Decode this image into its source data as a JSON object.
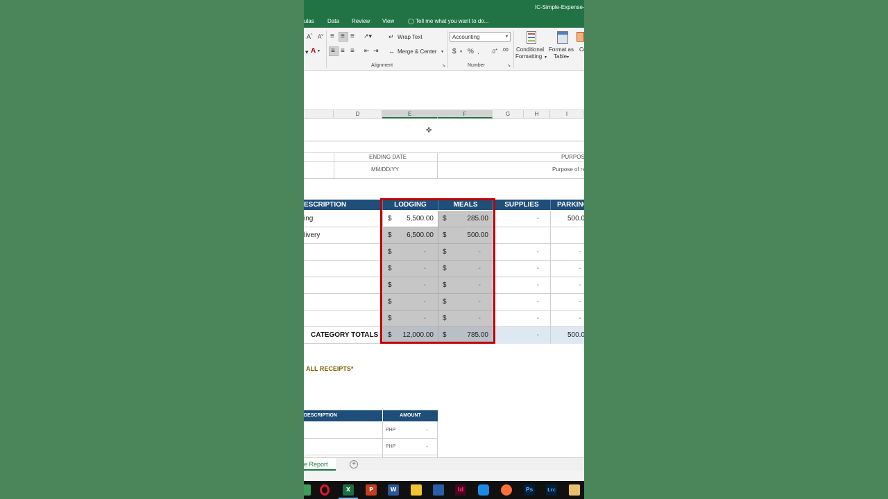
{
  "window": {
    "title": "IC-Simple-Expense-"
  },
  "menu_tabs": [
    "ulas",
    "Data",
    "Review",
    "View"
  ],
  "tell_me": "Tell me what you want to do...",
  "ribbon": {
    "wrap_text": "Wrap Text",
    "merge_center": "Merge & Center",
    "alignment_label": "Alignment",
    "number_format": "Accounting",
    "number_label": "Number",
    "dollar": "$",
    "percent": "%",
    "conditional_formatting_1": "Conditional",
    "conditional_formatting_2": "Formatting",
    "format_as_table_1": "Format as",
    "format_as_table_2": "Table",
    "cell_styles_short": "Ce"
  },
  "columns": [
    "D",
    "E",
    "F",
    "G",
    "H",
    "I"
  ],
  "info": {
    "ending_date_label": "ENDING DATE",
    "ending_date_value": "MM/DD/YY",
    "purpose_label": "PURPOSE",
    "purpose_value": "Purpose of re"
  },
  "table": {
    "headers": {
      "description": "ESCRIPTION",
      "lodging": "LODGING",
      "meals": "MEALS",
      "supplies": "SUPPLIES",
      "parking": "PARKING"
    },
    "currency": "$",
    "rows": [
      {
        "desc": "ing",
        "lodging": "5,500.00",
        "meals": "285.00",
        "supplies": "-",
        "parking": "500.0"
      },
      {
        "desc": "livery",
        "lodging": "6,500.00",
        "meals": "500.00",
        "supplies": "",
        "parking": ""
      },
      {
        "desc": "",
        "lodging": "-",
        "meals": "-",
        "supplies": "-",
        "parking": "-"
      },
      {
        "desc": "",
        "lodging": "-",
        "meals": "-",
        "supplies": "-",
        "parking": "-"
      },
      {
        "desc": "",
        "lodging": "-",
        "meals": "-",
        "supplies": "-",
        "parking": "-"
      },
      {
        "desc": "",
        "lodging": "-",
        "meals": "-",
        "supplies": "-",
        "parking": "-"
      },
      {
        "desc": "",
        "lodging": "-",
        "meals": "-",
        "supplies": "-",
        "parking": "-"
      }
    ],
    "totals": {
      "label": "CATEGORY TOTALS",
      "lodging": "12,000.00",
      "meals": "785.00",
      "supplies": "-",
      "parking": "500.0"
    }
  },
  "receipts_note": "ALL RECEIPTS*",
  "lower_table": {
    "desc_header": "DESCRIPTION",
    "amount_header": "AMOUNT",
    "rows": [
      {
        "currency": "PHP",
        "amount": "-"
      },
      {
        "currency": "PHP",
        "amount": "-"
      }
    ]
  },
  "sheet_tab": "e Report",
  "taskbar_apps": [
    "opera",
    "excel",
    "powerpoint",
    "word",
    "file-explorer",
    "photos",
    "indesign",
    "sync",
    "firefox",
    "photoshop",
    "lightroom-classic",
    "media-player"
  ],
  "taskbar_labels": {
    "indesign": "Id",
    "photoshop": "Ps",
    "lightroom": "Lrc",
    "excel": "X",
    "powerpoint": "P",
    "word": "W"
  },
  "colors": {
    "excel_green": "#217346",
    "header_navy": "#1f4e79",
    "selection_red": "#c00000",
    "background": "#4a8659"
  }
}
